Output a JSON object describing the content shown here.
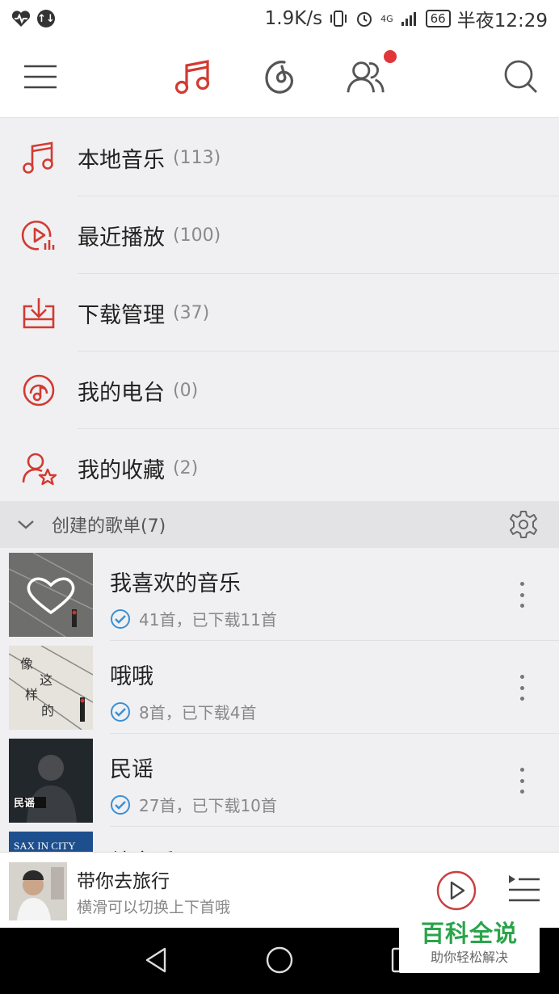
{
  "status_bar": {
    "speed": "1.9K/s",
    "network": "4G",
    "battery": "66",
    "time": "半夜12:29"
  },
  "top_nav": {
    "tabs": [
      {
        "icon": "music-icon",
        "active": true
      },
      {
        "icon": "netease-icon",
        "active": false
      },
      {
        "icon": "friends-icon",
        "active": false,
        "notification": true
      }
    ],
    "accent": "#d33a31"
  },
  "menu": {
    "items": [
      {
        "label": "本地音乐",
        "count": "(113)",
        "icon": "music-note-icon"
      },
      {
        "label": "最近播放",
        "count": "(100)",
        "icon": "recent-play-icon"
      },
      {
        "label": "下载管理",
        "count": "(37)",
        "icon": "download-icon"
      },
      {
        "label": "我的电台",
        "count": "(0)",
        "icon": "radio-icon"
      },
      {
        "label": "我的收藏",
        "count": "(2)",
        "icon": "favorite-user-icon"
      }
    ]
  },
  "section": {
    "label": "创建的歌单(7)"
  },
  "playlists": [
    {
      "name": "我喜欢的音乐",
      "meta": "41首，已下载11首",
      "cover": "heart-cover"
    },
    {
      "name": "哦哦",
      "meta": "8首，已下载4首",
      "cover": "sketch-cover"
    },
    {
      "name": "民谣",
      "meta": "27首，已下载10首",
      "cover": "artist-cover"
    },
    {
      "name": "纯音乐",
      "meta": "",
      "cover": "sax-cover",
      "cover_text": "SAX IN CITY"
    }
  ],
  "mini_player": {
    "title": "带你去旅行",
    "subtitle": "横滑可以切换上下首哦"
  },
  "watermark": {
    "title": "百科全说",
    "subtitle": "助你轻松解决"
  }
}
